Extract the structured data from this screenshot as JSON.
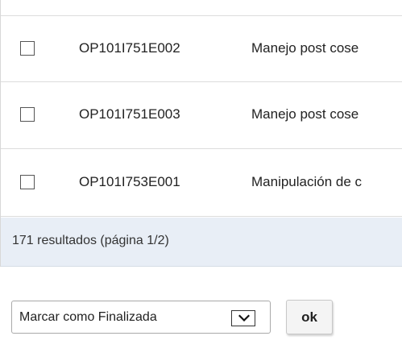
{
  "table": {
    "rows": [
      {
        "code": "OP101I751E002",
        "description": "Manejo post cose"
      },
      {
        "code": "OP101I751E003",
        "description": "Manejo post cose"
      },
      {
        "code": "OP101I753E001",
        "description": "Manipulación de c"
      }
    ]
  },
  "results": {
    "summary": "171 resultados (página 1/2)"
  },
  "actions": {
    "select_value": "Marcar como Finalizada",
    "ok_label": "ok"
  },
  "icons": {
    "dropdown": "chevron-down-icon",
    "checkbox": "checkbox-icon"
  }
}
